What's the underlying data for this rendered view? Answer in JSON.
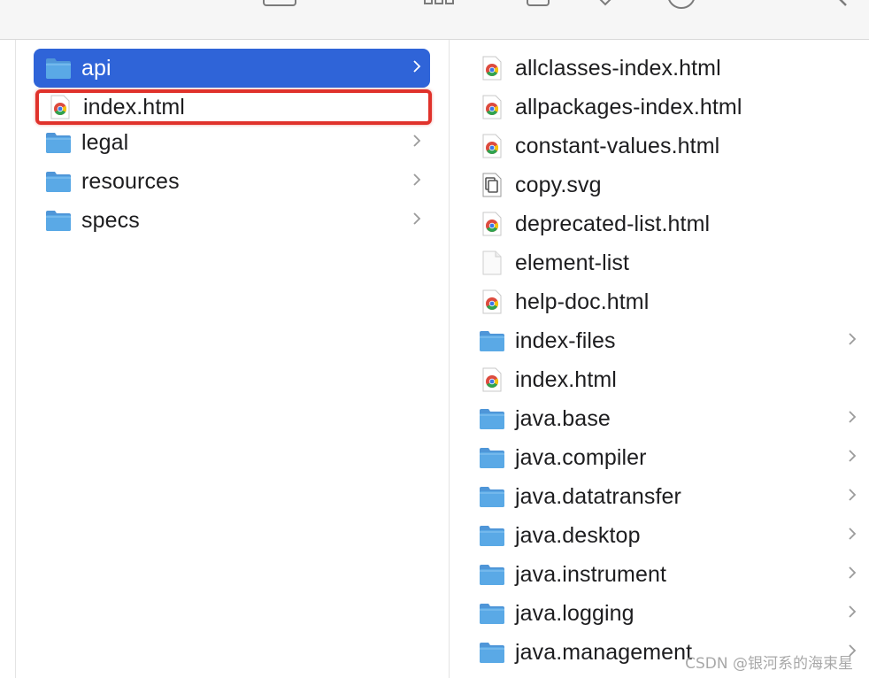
{
  "sidebar_column": {
    "items": [
      {
        "label": "api",
        "kind": "folder",
        "selected": true,
        "icon": "folder-icon"
      },
      {
        "label": "index.html",
        "kind": "html",
        "highlighted": true,
        "icon": "chrome-html-icon"
      },
      {
        "label": "legal",
        "kind": "folder",
        "icon": "folder-icon"
      },
      {
        "label": "resources",
        "kind": "folder",
        "icon": "folder-icon"
      },
      {
        "label": "specs",
        "kind": "folder",
        "icon": "folder-icon"
      }
    ]
  },
  "content_column": {
    "items": [
      {
        "label": "allclasses-index.html",
        "kind": "html"
      },
      {
        "label": "allpackages-index.html",
        "kind": "html"
      },
      {
        "label": "constant-values.html",
        "kind": "html"
      },
      {
        "label": "copy.svg",
        "kind": "svg"
      },
      {
        "label": "deprecated-list.html",
        "kind": "html"
      },
      {
        "label": "element-list",
        "kind": "doc"
      },
      {
        "label": "help-doc.html",
        "kind": "html"
      },
      {
        "label": "index-files",
        "kind": "folder"
      },
      {
        "label": "index.html",
        "kind": "html"
      },
      {
        "label": "java.base",
        "kind": "folder"
      },
      {
        "label": "java.compiler",
        "kind": "folder"
      },
      {
        "label": "java.datatransfer",
        "kind": "folder"
      },
      {
        "label": "java.desktop",
        "kind": "folder"
      },
      {
        "label": "java.instrument",
        "kind": "folder"
      },
      {
        "label": "java.logging",
        "kind": "folder"
      },
      {
        "label": "java.management",
        "kind": "folder"
      }
    ]
  },
  "watermark": "CSDN @银河系的海束星",
  "colors": {
    "selection": "#2f64d8",
    "highlight_box": "#e0322b",
    "folder": "#5aa9e6"
  }
}
